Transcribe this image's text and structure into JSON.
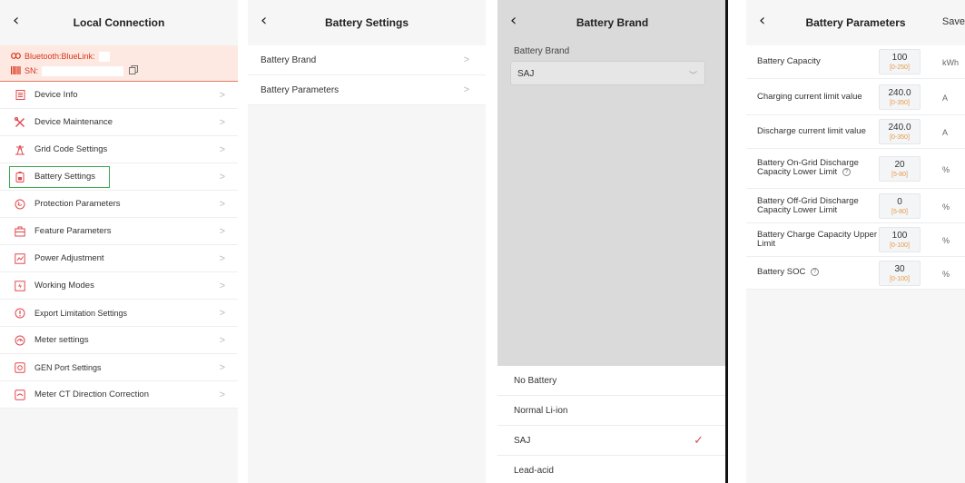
{
  "local_connection": {
    "title": "Local Connection",
    "bluetooth_label": "Bluetooth:BlueLink:",
    "sn_label": "SN:",
    "menu": [
      {
        "label": "Device Info",
        "icon": "document-icon"
      },
      {
        "label": "Device Maintenance",
        "icon": "tools-icon"
      },
      {
        "label": "Grid Code Settings",
        "icon": "grid-tower-icon"
      },
      {
        "label": "Battery Settings",
        "icon": "battery-icon"
      },
      {
        "label": "Protection Parameters",
        "icon": "shield-icon"
      },
      {
        "label": "Feature Parameters",
        "icon": "toolbox-icon"
      },
      {
        "label": "Power Adjustment",
        "icon": "power-adjust-icon"
      },
      {
        "label": "Working Modes",
        "icon": "mode-icon"
      },
      {
        "label": "Export Limitation Settings",
        "icon": "export-limit-icon"
      },
      {
        "label": "Meter settings",
        "icon": "meter-icon"
      },
      {
        "label": "GEN Port Settings",
        "icon": "gen-port-icon"
      },
      {
        "label": "Meter CT Direction Correction",
        "icon": "ct-direction-icon"
      }
    ]
  },
  "battery_settings": {
    "title": "Battery Settings",
    "items": [
      {
        "label": "Battery Brand"
      },
      {
        "label": "Battery Parameters"
      }
    ]
  },
  "battery_brand": {
    "title": "Battery Brand",
    "field_label": "Battery Brand",
    "selected": "SAJ",
    "options": [
      {
        "label": "No Battery",
        "checked": false
      },
      {
        "label": "Normal Li-ion",
        "checked": false
      },
      {
        "label": "SAJ",
        "checked": true
      },
      {
        "label": "Lead-acid",
        "checked": false
      }
    ]
  },
  "battery_parameters": {
    "title": "Battery Parameters",
    "save_label": "Save",
    "params": [
      {
        "label": "Battery Capacity",
        "value": "100",
        "range": "[0-250]",
        "unit": "kWh",
        "help": false
      },
      {
        "label": "Charging current limit value",
        "value": "240.0",
        "range": "[0-350]",
        "unit": "A",
        "help": false
      },
      {
        "label": "Discharge current limit value",
        "value": "240.0",
        "range": "[0-350]",
        "unit": "A",
        "help": false
      },
      {
        "label": "Battery On-Grid Discharge Capacity Lower Limit",
        "value": "20",
        "range": "[5-80]",
        "unit": "%",
        "help": true
      },
      {
        "label": "Battery Off-Grid Discharge Capacity Lower Limit",
        "value": "0",
        "range": "[5-80]",
        "unit": "%",
        "help": false
      },
      {
        "label": "Battery Charge Capacity Upper Limit",
        "value": "100",
        "range": "[0-100]",
        "unit": "%",
        "help": false
      },
      {
        "label": "Battery SOC",
        "value": "30",
        "range": "[0-100]",
        "unit": "%",
        "help": true
      }
    ]
  },
  "colors": {
    "highlight": "#3aaa4e",
    "accent_red": "#e0484d",
    "range_orange": "#e49a45",
    "connection_bg": "#fde9e1"
  }
}
